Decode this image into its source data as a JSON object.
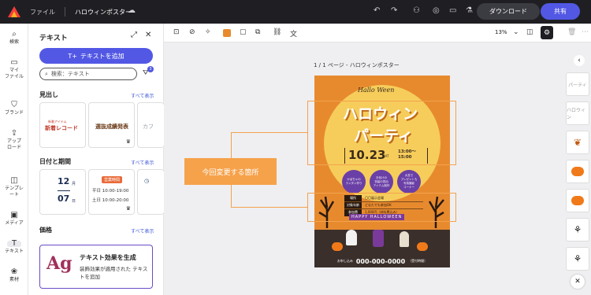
{
  "topbar": {
    "file_label": "ファイル",
    "doc_title": "ハロウィンポスター",
    "download_label": "ダウンロード",
    "share_label": "共有"
  },
  "rail": [
    {
      "label": "検索",
      "icon": "search-icon"
    },
    {
      "label": "マイ\nファイル",
      "icon": "folder-icon"
    },
    {
      "label": "ブランド",
      "icon": "brand-icon"
    },
    {
      "label": "アップ\nロード",
      "icon": "upload-icon"
    },
    {
      "label": "テンプレ\nート",
      "icon": "template-icon"
    },
    {
      "label": "メディア",
      "icon": "media-icon"
    },
    {
      "label": "テキスト",
      "icon": "text-icon"
    },
    {
      "label": "素材",
      "icon": "element-icon"
    }
  ],
  "panel": {
    "title": "テキスト",
    "add_button": "テキストを追加",
    "search_placeholder": "検索：テキスト",
    "filter_count": "3",
    "sections": [
      {
        "title": "見出し",
        "link": "すべて表示"
      },
      {
        "title": "日付と期間",
        "link": "すべて表示"
      },
      {
        "title": "価格",
        "link": "すべて表示"
      }
    ],
    "heading_cards": [
      {
        "sub": "新着アイテム",
        "main": "新着レコード"
      },
      {
        "sub": "",
        "main": "選抜成績発表"
      },
      {
        "sub": "",
        "main": "カフ"
      }
    ],
    "date_cards": [
      {
        "main": "12",
        "sub1": "月",
        "date2": "07",
        "sub2": "日"
      },
      {
        "badge": "営業時間",
        "line1": "平日 10:00-19:00",
        "line2": "土日 10:00-20:00"
      }
    ],
    "effect_card": {
      "glyph": "Ag",
      "title": "テキスト効果を生成",
      "description": "装飾効果が適用された テキストを追加"
    }
  },
  "context_toolbar": {
    "zoom": "13%"
  },
  "canvas": {
    "page_label": "1 / 1 ページ - ハロウィンポスター",
    "callout": "今回変更する箇所"
  },
  "poster": {
    "script_title": "Hallo Ween",
    "title_line1": "ハロウィン",
    "title_line2": "パーティ",
    "date": "10.23",
    "weekday": "SAT",
    "time": "13:00～\n15:00",
    "circle1": "かぼちゃの\nランタン作り",
    "circle2": "お化けの\n衣装の貸出\nアイテム制作",
    "circle3": "大賞で\nプレゼントも\n写真撮影\nコーナー",
    "info_rows": [
      {
        "key": "場所",
        "value": "〇〇展示会場"
      },
      {
        "key": "対象年齢",
        "value": "どなたでも参加OK"
      },
      {
        "key": "参加費",
        "value": "1,000円（材料費込み）"
      }
    ],
    "banner": "HAPPY HALLOWEEN",
    "footer_label": "お申し込み",
    "footer_phone": "000-000-0000",
    "footer_note": "（受付時間）"
  },
  "right_thumbs": [
    "パーティ",
    "ハロウィン",
    "",
    "",
    "",
    "",
    "",
    ""
  ],
  "colors": {
    "topbar": "#1f1f23",
    "accent": "#5258e4",
    "poster_orange": "#e78a2e",
    "moon_yellow": "#f6cd5b",
    "callout": "#f6a24b",
    "circle_purple": "#6a3fa6"
  }
}
